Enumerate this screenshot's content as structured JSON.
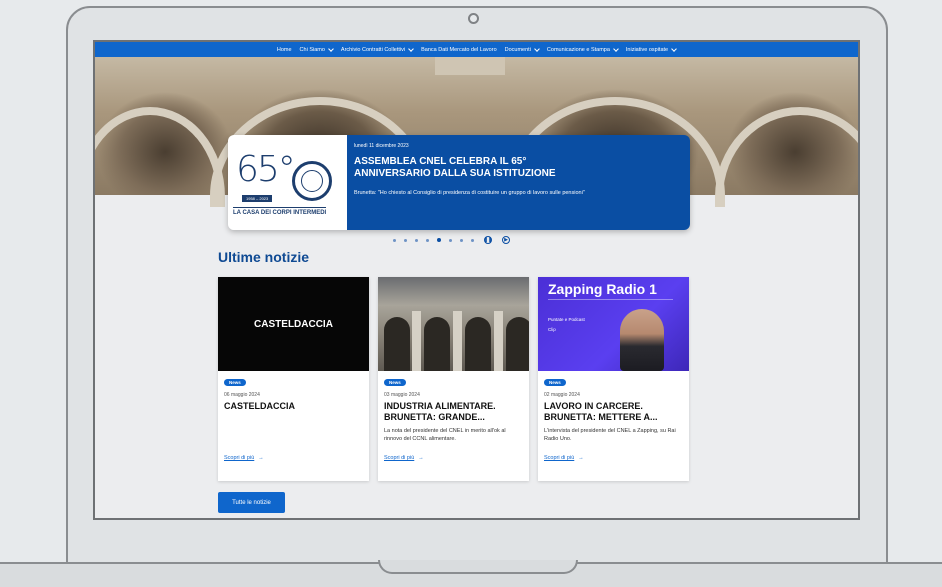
{
  "nav": {
    "items": [
      {
        "label": "Home",
        "dropdown": false
      },
      {
        "label": "Chi Siamo",
        "dropdown": true
      },
      {
        "label": "Archivio Contratti Collettivi",
        "dropdown": true
      },
      {
        "label": "Banca Dati Mercato del Lavoro",
        "dropdown": false
      },
      {
        "label": "Documenti",
        "dropdown": true
      },
      {
        "label": "Comunicazione e Stampa",
        "dropdown": true
      },
      {
        "label": "Iniziative ospitate",
        "dropdown": true
      }
    ]
  },
  "hero": {
    "logo": {
      "number": "65°",
      "years": "1958 – 2023",
      "tagline": "LA CASA DEI CORPI INTERMEDI"
    },
    "date": "lunedì 11 dicembre 2023",
    "title": "ASSEMBLEA CNEL CELEBRA IL 65° ANNIVERSARIO DALLA SUA ISTITUZIONE",
    "subtitle": "Brunetta: \"Ho chiesto al Consiglio di presidenza di costituire un gruppo di lavoro sulle pensioni\"",
    "slides": 9,
    "active_slide": 5,
    "pause_icon": "pause-icon",
    "next_icon": "play-icon"
  },
  "news": {
    "title": "Ultime notizie",
    "cards": [
      {
        "image_text": "CASTELDACCIA",
        "badge": "News",
        "date": "06 maggio 2024",
        "title": "CASTELDACCIA",
        "desc": "",
        "link": "Scopri di più"
      },
      {
        "image_text": "",
        "badge": "News",
        "date": "03 maggio 2024",
        "title": "INDUSTRIA ALIMENTARE. BRUNETTA: GRANDE...",
        "desc": "La nota del presidente del CNEL in merito all'ok al rinnovo del CCNL alimentare.",
        "link": "Scopri di più"
      },
      {
        "image_text": "Zapping Radio 1",
        "image_sub": "Puntate e Podcast",
        "image_clip": "Clip",
        "badge": "News",
        "date": "02 maggio 2024",
        "title": "LAVORO IN CARCERE. BRUNETTA: METTERE A...",
        "desc": "L'intervista del presidente del CNEL a Zapping, su Rai Radio Uno.",
        "link": "Scopri di più"
      }
    ],
    "all_button": "Tutte le notizie"
  },
  "colors": {
    "nav": "#0f66cc",
    "hero_panel": "#0a4ea3",
    "title": "#0f4a93"
  }
}
